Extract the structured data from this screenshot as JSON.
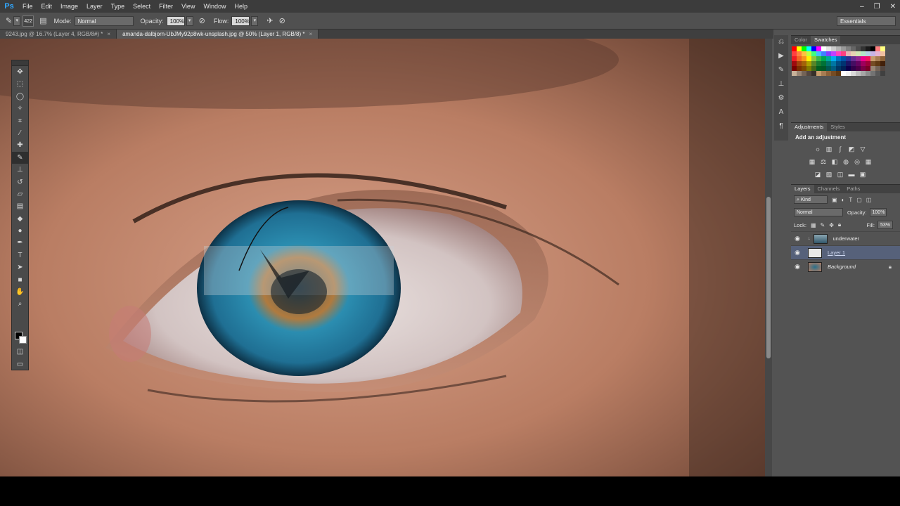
{
  "app": {
    "logo": "Ps"
  },
  "menu": [
    "File",
    "Edit",
    "Image",
    "Layer",
    "Type",
    "Select",
    "Filter",
    "View",
    "Window",
    "Help"
  ],
  "window_controls": {
    "minimize": "–",
    "restore": "❐",
    "close": "✕"
  },
  "options": {
    "brush_size": "422",
    "mode_label": "Mode:",
    "mode_value": "Normal",
    "opacity_label": "Opacity:",
    "opacity_value": "100%",
    "flow_label": "Flow:",
    "flow_value": "100%",
    "workspace": "Essentials"
  },
  "tabs": [
    {
      "label": "9243.jpg @ 16.7% (Layer 4, RGB/8#) *",
      "active": false
    },
    {
      "label": "amanda-dalbjorn-UbJMy92p8wk-unsplash.jpg @ 50% (Layer 1, RGB/8) *",
      "active": true
    }
  ],
  "panels": {
    "color_tabs": [
      "Color",
      "Swatches"
    ],
    "adjust_tabs": [
      "Adjustments",
      "Styles"
    ],
    "adjust_title": "Add an adjustment",
    "layers_tabs": [
      "Layers",
      "Channels",
      "Paths"
    ],
    "kind_label": "Kind",
    "blend_mode": "Normal",
    "opacity_label": "Opacity:",
    "opacity_value": "100%",
    "lock_label": "Lock:",
    "fill_label": "Fill:",
    "fill_value": "53%"
  },
  "layers": [
    {
      "name": "underwater",
      "italic": false,
      "selected": false,
      "locked": false
    },
    {
      "name": "Layer 1",
      "italic": false,
      "selected": true,
      "locked": false
    },
    {
      "name": "Background",
      "italic": true,
      "selected": false,
      "locked": true
    }
  ],
  "colors": {
    "accent": "#31a8ff",
    "iris": "#2a8fb0",
    "skin": "#c98e72"
  }
}
